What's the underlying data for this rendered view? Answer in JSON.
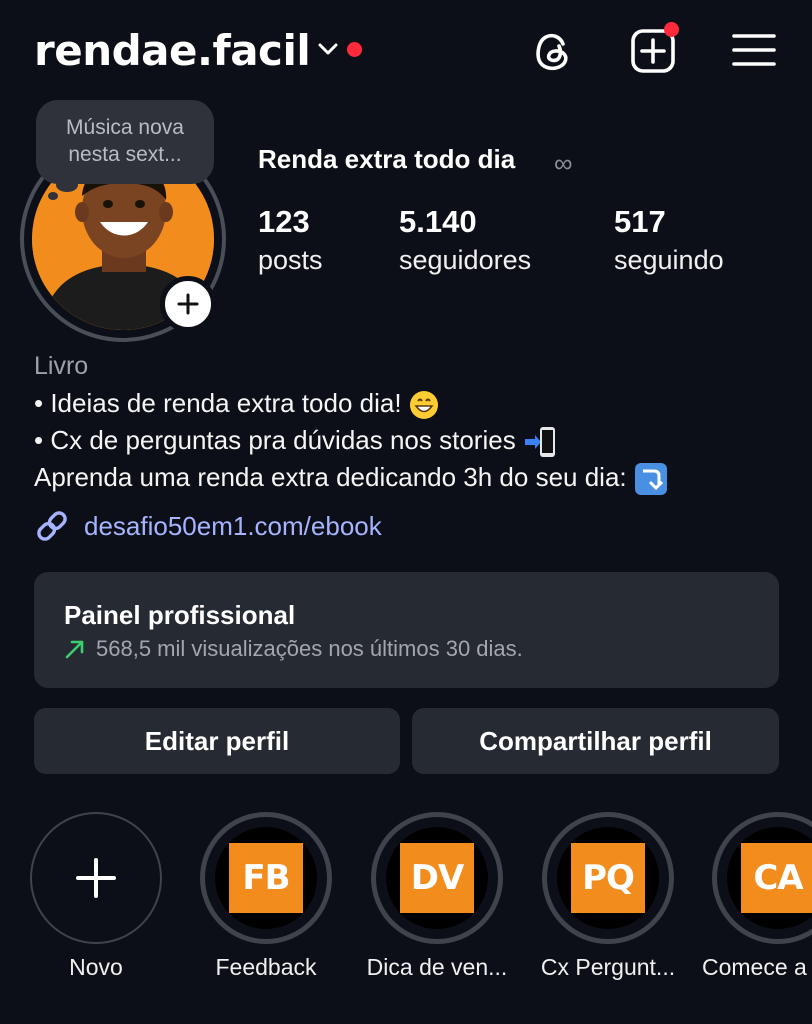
{
  "header": {
    "username": "rendae.facil",
    "icons": [
      "chevron-down-icon",
      "threads-icon",
      "new-post-icon",
      "menu-icon"
    ],
    "notification_color": "#ff2a3c"
  },
  "profile": {
    "note": "Música nova nesta sext...",
    "display_name": "Renda extra todo dia",
    "name_suffix": "∞",
    "stats": [
      {
        "value": "123",
        "label": "posts"
      },
      {
        "value": "5.140",
        "label": "seguidores"
      },
      {
        "value": "517",
        "label": "seguindo"
      }
    ]
  },
  "bio": {
    "category": "Livro",
    "lines": [
      "• Ideias de renda extra todo dia!",
      "• Cx de perguntas pra dúvidas nos stories",
      "Aprenda uma renda extra dedicando 3h do seu dia:"
    ],
    "link": "desafio50em1.com/ebook"
  },
  "panel": {
    "title": "Painel profissional",
    "subtitle": "568,5 mil visualizações nos últimos 30 dias."
  },
  "buttons": {
    "edit": "Editar perfil",
    "share": "Compartilhar perfil"
  },
  "highlights": [
    {
      "code": "",
      "label": "Novo"
    },
    {
      "code": "FB",
      "label": "Feedback"
    },
    {
      "code": "DV",
      "label": "Dica de ven..."
    },
    {
      "code": "PQ",
      "label": "Cx Pergunt..."
    },
    {
      "code": "CA",
      "label": "Comece a"
    }
  ],
  "colors": {
    "background": "#0c0f17",
    "card": "#262a33",
    "accent_orange": "#f28c1c",
    "link": "#a6b4ff",
    "trend_green": "#3ccf6e"
  }
}
